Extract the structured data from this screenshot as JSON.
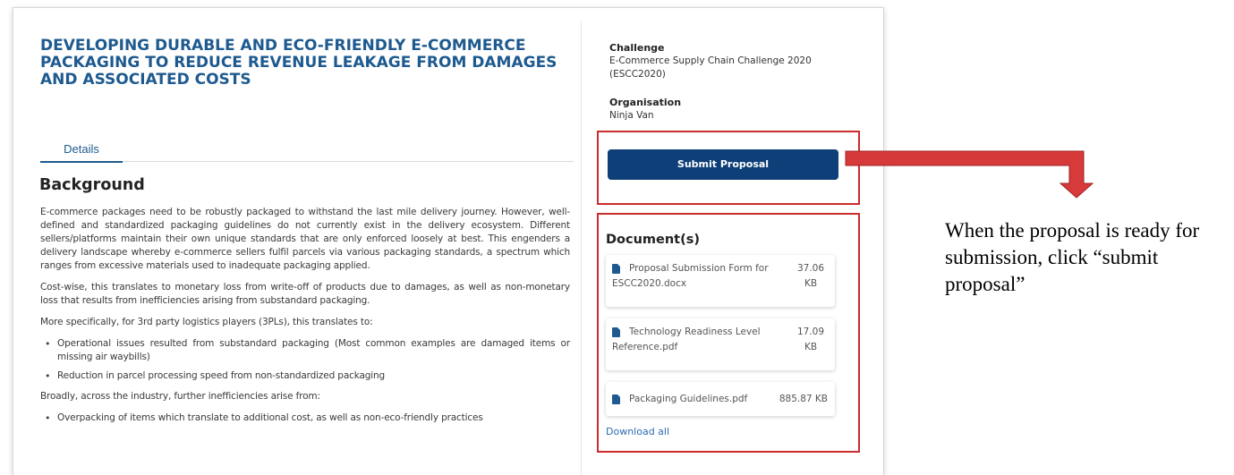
{
  "page": {
    "title": "DEVELOPING DURABLE AND ECO-FRIENDLY E-COMMERCE PACKAGING TO REDUCE REVENUE LEAKAGE FROM DAMAGES AND ASSOCIATED COSTS",
    "tabs": [
      {
        "label": "Details",
        "active": true
      }
    ]
  },
  "background": {
    "heading": "Background",
    "p1": "E-commerce packages need to be robustly packaged to withstand the last mile delivery journey. However, well-defined and standardized packaging guidelines do not currently exist in the delivery ecosystem. Different sellers/platforms maintain their own unique standards that are only enforced loosely at best. This engenders a delivery landscape whereby e-commerce sellers fulfil parcels via various packaging standards, a spectrum which ranges from excessive materials used to inadequate packaging applied.",
    "p2": "Cost-wise, this translates to monetary loss from write-off of products due to damages, as well as non-monetary loss that results from inefficiencies arising from substandard packaging.",
    "p3": "More specifically, for 3rd party logistics players (3PLs), this translates to:",
    "list1": [
      "Operational issues resulted from substandard packaging (Most common examples are damaged items or missing air waybills)",
      "Reduction in parcel processing speed from non-standardized packaging"
    ],
    "p4": "Broadly, across the industry, further inefficiencies arise from:",
    "list2": [
      "Overpacking of items which translate to additional cost, as well as non-eco-friendly practices"
    ]
  },
  "sidebar": {
    "challenge_label": "Challenge",
    "challenge_value": "E-Commerce Supply Chain Challenge 2020 (ESCC2020)",
    "organisation_label": "Organisation",
    "organisation_value": "Ninja Van",
    "submit_label": "Submit Proposal",
    "documents_title": "Document(s)",
    "documents": [
      {
        "name": "Proposal Submission Form for ESCC2020.docx",
        "size": "37.06 KB"
      },
      {
        "name": "Technology Readiness Level Reference.pdf",
        "size": "17.09 KB"
      },
      {
        "name": "Packaging Guidelines.pdf",
        "size": "885.87 KB"
      }
    ],
    "download_all": "Download all"
  },
  "annotation": {
    "text": "When the proposal is ready for submission, click “submit proposal”"
  },
  "colors": {
    "title_blue": "#1e5a8f",
    "button_navy": "#0f3f78",
    "highlight_red": "#cc2b2b",
    "arrow_red": "#d63a3a"
  }
}
